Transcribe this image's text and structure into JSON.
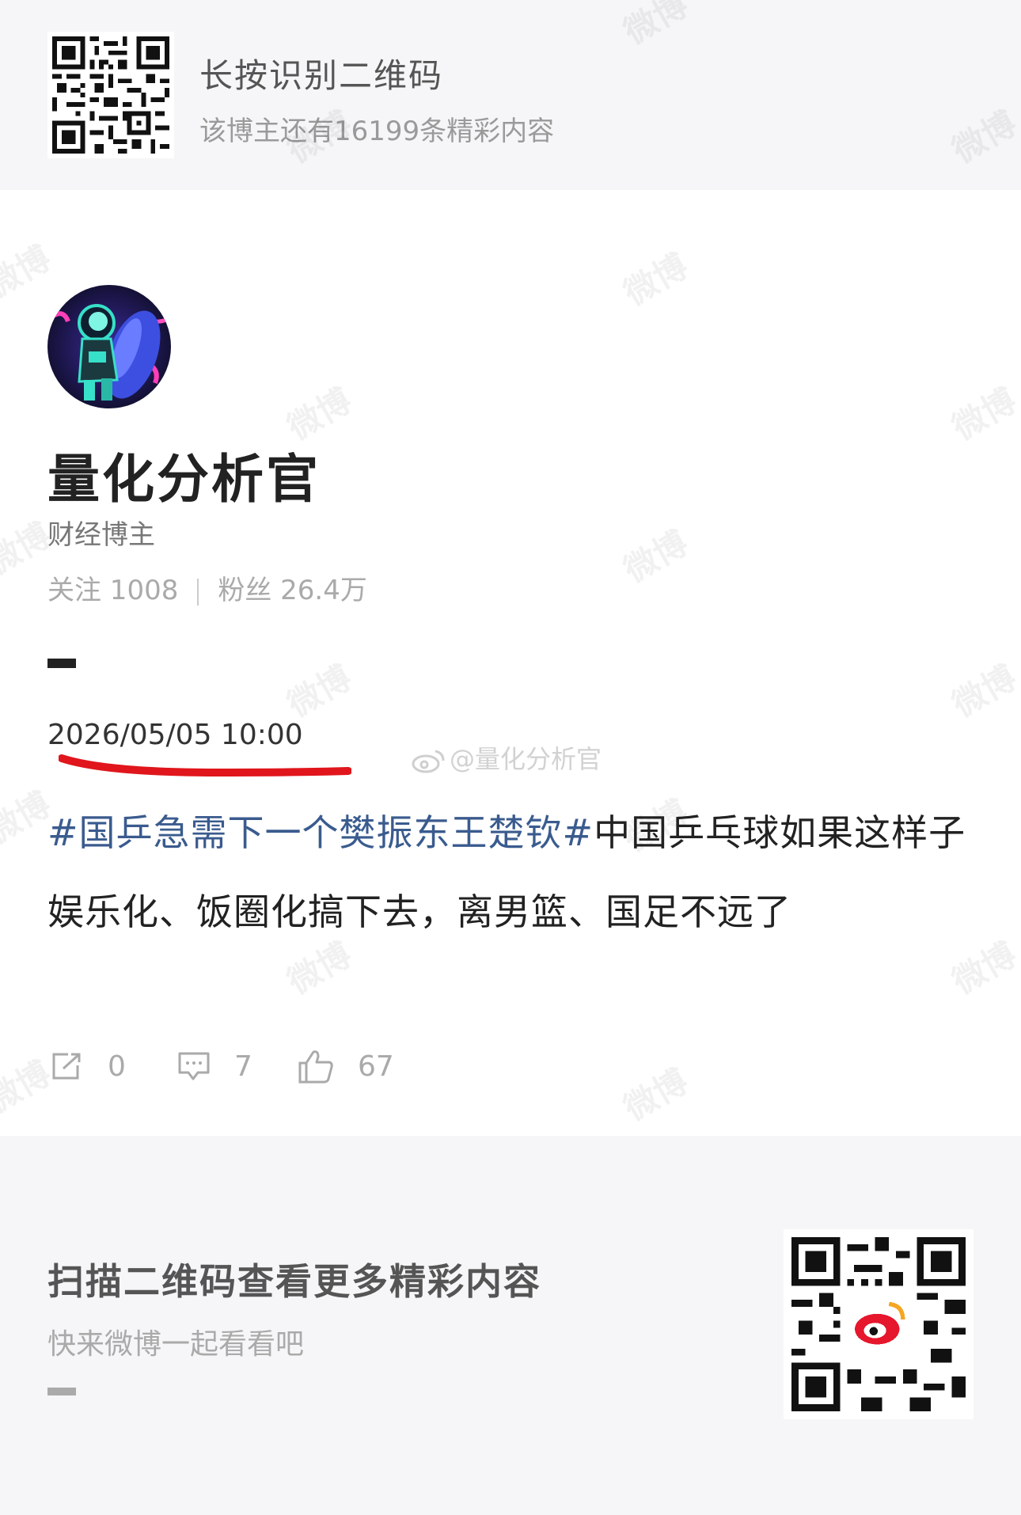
{
  "top_banner": {
    "title": "长按识别二维码",
    "subtitle": "该博主还有16199条精彩内容"
  },
  "author": {
    "name": "量化分析官",
    "role": "财经博主",
    "following_label": "关注 1008",
    "followers_label": "粉丝 26.4万"
  },
  "post": {
    "date": "2026/05/05 10:00",
    "topic": "#国乒急需下一个樊振东王楚钦#",
    "text": "中国乒乓球如果这样子娱乐化、饭圈化搞下去，离男篮、国足不远了",
    "watermark_handle": "@量化分析官"
  },
  "actions": {
    "share_count": "0",
    "comment_count": "7",
    "like_count": "67"
  },
  "footer": {
    "title": "扫描二维码查看更多精彩内容",
    "subtitle": "快来微博一起看看吧"
  },
  "watermark_text": "微博",
  "colors": {
    "topic_link": "#3a5b8e",
    "underline_annotation": "#e0161c",
    "page_background": "#f6f6f8"
  }
}
